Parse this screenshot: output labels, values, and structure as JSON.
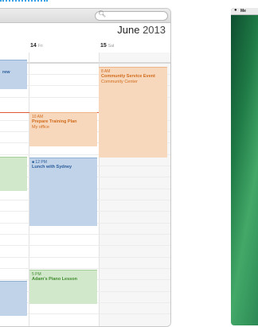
{
  "calendar": {
    "month": "June",
    "year": "2013",
    "days": [
      {
        "num": "14",
        "dow": "Fri"
      },
      {
        "num": "15",
        "dow": "Sat"
      }
    ],
    "events": [
      {
        "id": "left-top",
        "time": "",
        "title": "rew",
        "location": "",
        "color": "blue"
      },
      {
        "id": "community",
        "time": "8 AM",
        "title": "Community Service Event",
        "location": "Community Center",
        "color": "orange"
      },
      {
        "id": "training",
        "time": "10 AM",
        "title": "Prepare Training Plan",
        "location": "My office",
        "color": "orange"
      },
      {
        "id": "lunch",
        "time": "12 PM",
        "title": "Lunch with Sydney",
        "location": "",
        "color": "blue"
      },
      {
        "id": "piano",
        "time": "5 PM",
        "title": "Adam's Piano Lesson",
        "location": "",
        "color": "green"
      }
    ]
  },
  "desktop": {
    "menu_label": "Me"
  },
  "colors": {
    "blue_event": "#c0d3e9",
    "orange_event": "#f7d8bd",
    "green_event": "#d2e8cb",
    "now_line": "#e05a3a",
    "accent_dots": "#39a3e3"
  }
}
